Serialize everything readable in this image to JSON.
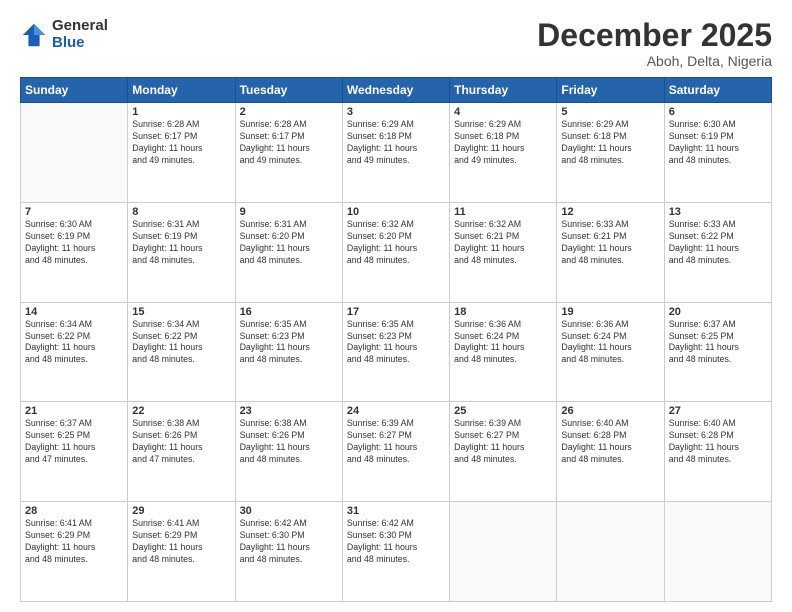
{
  "logo": {
    "general": "General",
    "blue": "Blue"
  },
  "title": "December 2025",
  "location": "Aboh, Delta, Nigeria",
  "weekdays": [
    "Sunday",
    "Monday",
    "Tuesday",
    "Wednesday",
    "Thursday",
    "Friday",
    "Saturday"
  ],
  "weeks": [
    [
      {
        "day": null
      },
      {
        "day": "1",
        "sunrise": "6:28 AM",
        "sunset": "6:17 PM",
        "daylight": "11 hours and 49 minutes."
      },
      {
        "day": "2",
        "sunrise": "6:28 AM",
        "sunset": "6:17 PM",
        "daylight": "11 hours and 49 minutes."
      },
      {
        "day": "3",
        "sunrise": "6:29 AM",
        "sunset": "6:18 PM",
        "daylight": "11 hours and 49 minutes."
      },
      {
        "day": "4",
        "sunrise": "6:29 AM",
        "sunset": "6:18 PM",
        "daylight": "11 hours and 49 minutes."
      },
      {
        "day": "5",
        "sunrise": "6:29 AM",
        "sunset": "6:18 PM",
        "daylight": "11 hours and 48 minutes."
      },
      {
        "day": "6",
        "sunrise": "6:30 AM",
        "sunset": "6:19 PM",
        "daylight": "11 hours and 48 minutes."
      }
    ],
    [
      {
        "day": "7",
        "sunrise": "6:30 AM",
        "sunset": "6:19 PM",
        "daylight": "11 hours and 48 minutes."
      },
      {
        "day": "8",
        "sunrise": "6:31 AM",
        "sunset": "6:19 PM",
        "daylight": "11 hours and 48 minutes."
      },
      {
        "day": "9",
        "sunrise": "6:31 AM",
        "sunset": "6:20 PM",
        "daylight": "11 hours and 48 minutes."
      },
      {
        "day": "10",
        "sunrise": "6:32 AM",
        "sunset": "6:20 PM",
        "daylight": "11 hours and 48 minutes."
      },
      {
        "day": "11",
        "sunrise": "6:32 AM",
        "sunset": "6:21 PM",
        "daylight": "11 hours and 48 minutes."
      },
      {
        "day": "12",
        "sunrise": "6:33 AM",
        "sunset": "6:21 PM",
        "daylight": "11 hours and 48 minutes."
      },
      {
        "day": "13",
        "sunrise": "6:33 AM",
        "sunset": "6:22 PM",
        "daylight": "11 hours and 48 minutes."
      }
    ],
    [
      {
        "day": "14",
        "sunrise": "6:34 AM",
        "sunset": "6:22 PM",
        "daylight": "11 hours and 48 minutes."
      },
      {
        "day": "15",
        "sunrise": "6:34 AM",
        "sunset": "6:22 PM",
        "daylight": "11 hours and 48 minutes."
      },
      {
        "day": "16",
        "sunrise": "6:35 AM",
        "sunset": "6:23 PM",
        "daylight": "11 hours and 48 minutes."
      },
      {
        "day": "17",
        "sunrise": "6:35 AM",
        "sunset": "6:23 PM",
        "daylight": "11 hours and 48 minutes."
      },
      {
        "day": "18",
        "sunrise": "6:36 AM",
        "sunset": "6:24 PM",
        "daylight": "11 hours and 48 minutes."
      },
      {
        "day": "19",
        "sunrise": "6:36 AM",
        "sunset": "6:24 PM",
        "daylight": "11 hours and 48 minutes."
      },
      {
        "day": "20",
        "sunrise": "6:37 AM",
        "sunset": "6:25 PM",
        "daylight": "11 hours and 48 minutes."
      }
    ],
    [
      {
        "day": "21",
        "sunrise": "6:37 AM",
        "sunset": "6:25 PM",
        "daylight": "11 hours and 47 minutes."
      },
      {
        "day": "22",
        "sunrise": "6:38 AM",
        "sunset": "6:26 PM",
        "daylight": "11 hours and 47 minutes."
      },
      {
        "day": "23",
        "sunrise": "6:38 AM",
        "sunset": "6:26 PM",
        "daylight": "11 hours and 48 minutes."
      },
      {
        "day": "24",
        "sunrise": "6:39 AM",
        "sunset": "6:27 PM",
        "daylight": "11 hours and 48 minutes."
      },
      {
        "day": "25",
        "sunrise": "6:39 AM",
        "sunset": "6:27 PM",
        "daylight": "11 hours and 48 minutes."
      },
      {
        "day": "26",
        "sunrise": "6:40 AM",
        "sunset": "6:28 PM",
        "daylight": "11 hours and 48 minutes."
      },
      {
        "day": "27",
        "sunrise": "6:40 AM",
        "sunset": "6:28 PM",
        "daylight": "11 hours and 48 minutes."
      }
    ],
    [
      {
        "day": "28",
        "sunrise": "6:41 AM",
        "sunset": "6:29 PM",
        "daylight": "11 hours and 48 minutes."
      },
      {
        "day": "29",
        "sunrise": "6:41 AM",
        "sunset": "6:29 PM",
        "daylight": "11 hours and 48 minutes."
      },
      {
        "day": "30",
        "sunrise": "6:42 AM",
        "sunset": "6:30 PM",
        "daylight": "11 hours and 48 minutes."
      },
      {
        "day": "31",
        "sunrise": "6:42 AM",
        "sunset": "6:30 PM",
        "daylight": "11 hours and 48 minutes."
      },
      {
        "day": null
      },
      {
        "day": null
      },
      {
        "day": null
      }
    ]
  ]
}
